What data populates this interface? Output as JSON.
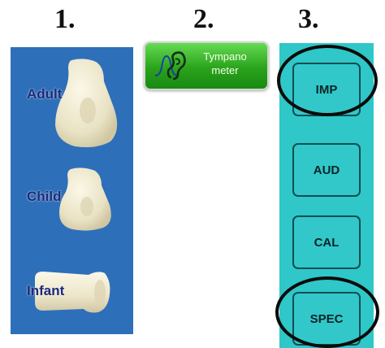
{
  "steps": {
    "one": "1.",
    "two": "2.",
    "three": "3."
  },
  "ear_tips": {
    "adult": "Adult",
    "child": "Child",
    "infant": "Infant"
  },
  "tympanometer": {
    "line1": "Tympano",
    "line2": "meter",
    "icon": "ear-icon"
  },
  "menu": {
    "imp": "IMP",
    "aud": "AUD",
    "cal": "CAL",
    "spec": "SPEC"
  },
  "colors": {
    "tips_panel": "#2e6fba",
    "menu_panel": "#2fc7c8",
    "tymp_button": "#2aa31c"
  }
}
